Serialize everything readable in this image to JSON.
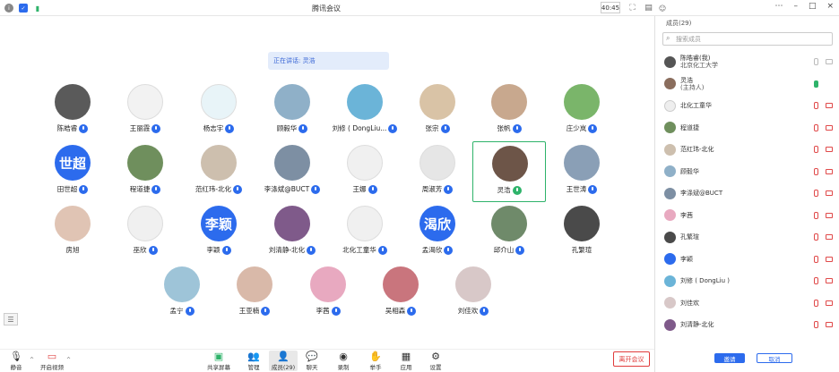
{
  "window": {
    "title": "腾讯会议",
    "duration": "40:45"
  },
  "speaking": "正在讲话: 灵浩",
  "participants": [
    {
      "name": "陈皓睿",
      "mic": "blue"
    },
    {
      "name": "王丽霞",
      "mic": "blue"
    },
    {
      "name": "杨志宇",
      "mic": "blue"
    },
    {
      "name": "顾毅华",
      "mic": "blue"
    },
    {
      "name": "刘修 ( DongLiu...",
      "mic": "blue"
    },
    {
      "name": "张宗",
      "mic": "blue"
    },
    {
      "name": "张帆",
      "mic": "blue"
    },
    {
      "name": "庄少岚",
      "mic": "blue"
    },
    {
      "name": "田世超",
      "mic": "blue",
      "initials": "世超"
    },
    {
      "name": "程道捷",
      "mic": "blue"
    },
    {
      "name": "范红玮-北化",
      "mic": "blue"
    },
    {
      "name": "李涤斌@BUCT",
      "mic": "blue"
    },
    {
      "name": "王娜",
      "mic": "blue"
    },
    {
      "name": "周淑芳",
      "mic": "blue"
    },
    {
      "name": "灵浩",
      "mic": "green"
    },
    {
      "name": "王世涛",
      "mic": "blue"
    },
    {
      "name": "房旭",
      "mic": ""
    },
    {
      "name": "巫欣",
      "mic": "blue"
    },
    {
      "name": "李颖",
      "mic": "blue",
      "initials": "李颖"
    },
    {
      "name": "刘清静-北化",
      "mic": "blue"
    },
    {
      "name": "北化工童华",
      "mic": "blue"
    },
    {
      "name": "孟渴欣",
      "mic": "blue",
      "initials": "渴欣"
    },
    {
      "name": "邱介山",
      "mic": "blue"
    },
    {
      "name": "孔繁瑄",
      "mic": ""
    },
    {
      "name": "孟宁",
      "mic": "blue"
    },
    {
      "name": "王亚楠",
      "mic": "blue"
    },
    {
      "name": "李茜",
      "mic": "blue"
    },
    {
      "name": "吴相森",
      "mic": "blue"
    },
    {
      "name": "刘佳欢",
      "mic": "blue"
    }
  ],
  "toolbar": {
    "mute": "静音",
    "video": "开启视频",
    "share": "共享屏幕",
    "manage": "管理",
    "members": "成员(29)",
    "chat": "聊天",
    "record": "录制",
    "hands": "举手",
    "apps": "应用",
    "settings": "设置",
    "leave": "离开会议"
  },
  "panel": {
    "title": "成员(29)",
    "search_placeholder": "搜索成员",
    "invite": "邀请",
    "cancel": "取消",
    "members": [
      {
        "name": "陈皓睿(我)",
        "sub": "北京化工大学",
        "mic": "idle"
      },
      {
        "name": "灵浩",
        "sub": "(主持人)",
        "mic": "on"
      },
      {
        "name": "北化工童华",
        "sub": "",
        "mic": "off"
      },
      {
        "name": "程道捷",
        "sub": "",
        "mic": "off"
      },
      {
        "name": "范红玮-北化",
        "sub": "",
        "mic": "off"
      },
      {
        "name": "顾毅华",
        "sub": "",
        "mic": "off"
      },
      {
        "name": "李涤斌@BUCT",
        "sub": "",
        "mic": "off"
      },
      {
        "name": "李茜",
        "sub": "",
        "mic": "off"
      },
      {
        "name": "孔繁瑄",
        "sub": "",
        "mic": "off"
      },
      {
        "name": "李颖",
        "sub": "",
        "mic": "off"
      },
      {
        "name": "刘修 ( DongLiu )",
        "sub": "",
        "mic": "off"
      },
      {
        "name": "刘佳欢",
        "sub": "",
        "mic": "off"
      },
      {
        "name": "刘清静-北化",
        "sub": "",
        "mic": "off"
      }
    ]
  }
}
